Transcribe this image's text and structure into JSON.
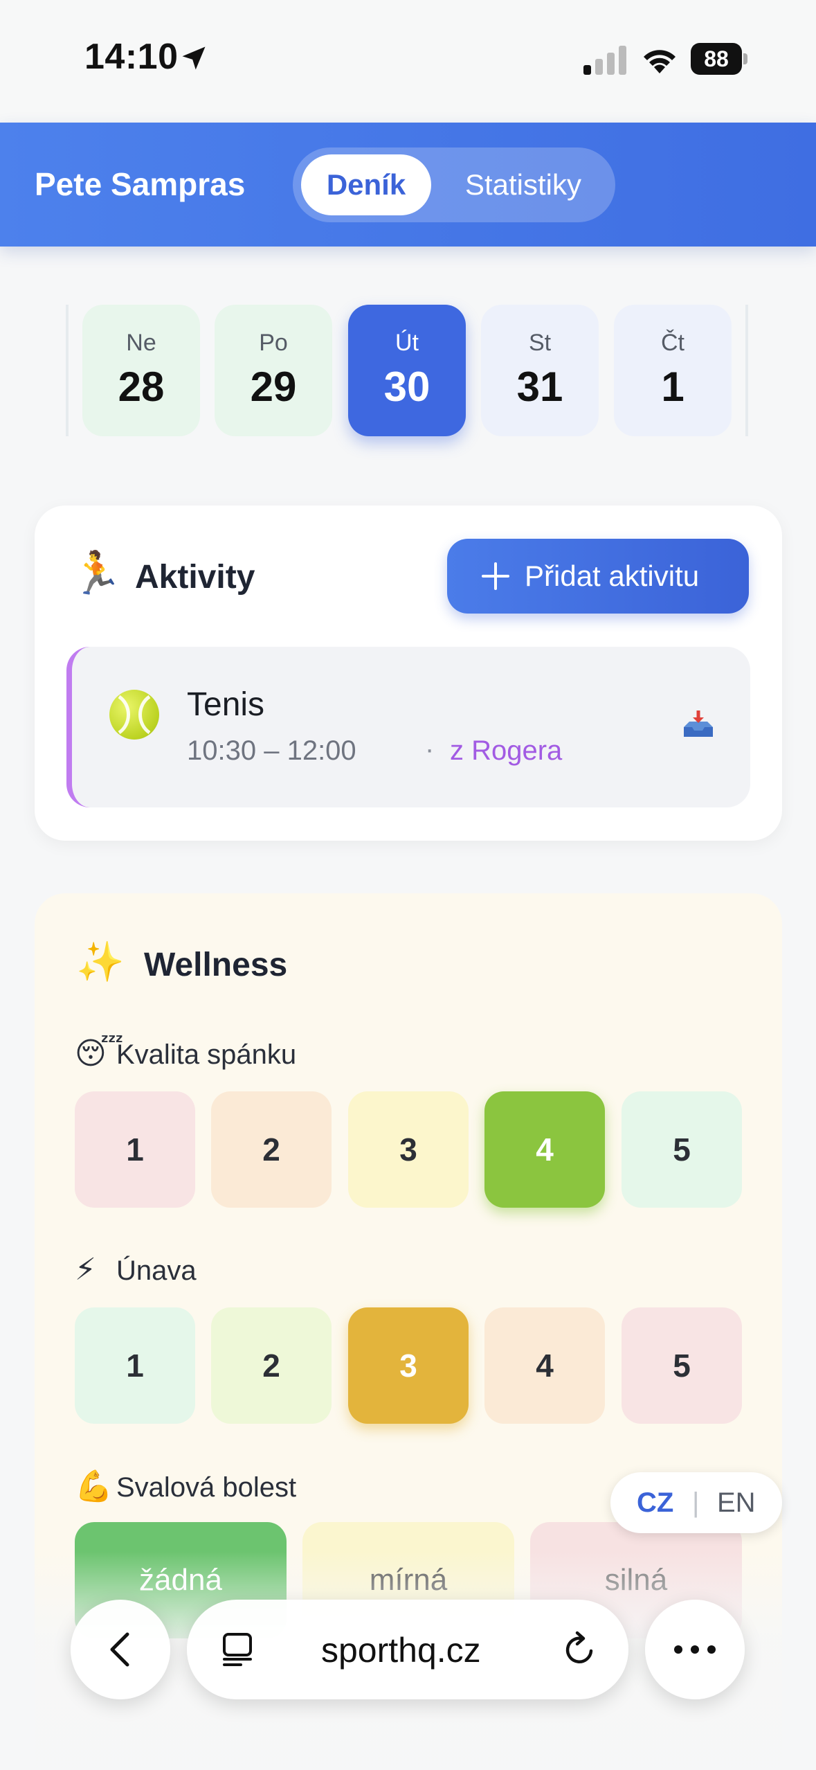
{
  "status_bar": {
    "time": "14:10",
    "battery": "88"
  },
  "header": {
    "user_name": "Pete Sampras",
    "tabs": [
      {
        "label": "Deník",
        "active": true
      },
      {
        "label": "Statistiky",
        "active": false
      }
    ]
  },
  "days": [
    {
      "weekday": "Ne",
      "date": "28",
      "state": "past"
    },
    {
      "weekday": "Po",
      "date": "29",
      "state": "past"
    },
    {
      "weekday": "Út",
      "date": "30",
      "state": "selected"
    },
    {
      "weekday": "St",
      "date": "31",
      "state": "future"
    },
    {
      "weekday": "Čt",
      "date": "1",
      "state": "future"
    }
  ],
  "activities": {
    "title": "Aktivity",
    "emoji": "🏃",
    "add_label": "Přidat aktivitu",
    "items": [
      {
        "name": "Tenis",
        "time": "10:30 – 12:00",
        "separator": "·",
        "from": "z Rogera",
        "icon": "tennis-ball-icon",
        "accent": "#c07cf0"
      }
    ]
  },
  "wellness": {
    "title": "Wellness",
    "emoji": "✨",
    "sleep": {
      "label": "Kvalita spánku",
      "emoji": "😴",
      "options": [
        "1",
        "2",
        "3",
        "4",
        "5"
      ],
      "selected": "4"
    },
    "fatigue": {
      "label": "Únava",
      "emoji": "⚡",
      "options": [
        "1",
        "2",
        "3",
        "4",
        "5"
      ],
      "selected": "3"
    },
    "soreness": {
      "label": "Svalová bolest",
      "emoji": "💪",
      "options": [
        "žádná",
        "mírná",
        "silná"
      ],
      "selected": "žádná"
    }
  },
  "language": {
    "cz": "CZ",
    "separator": "|",
    "en": "EN",
    "active": "CZ"
  },
  "browser": {
    "url": "sporthq.cz"
  },
  "colors": {
    "primary": "#3e68e0",
    "selected_green": "#8bc53f",
    "selected_amber": "#e3b43c",
    "accent_purple": "#a25be3"
  }
}
